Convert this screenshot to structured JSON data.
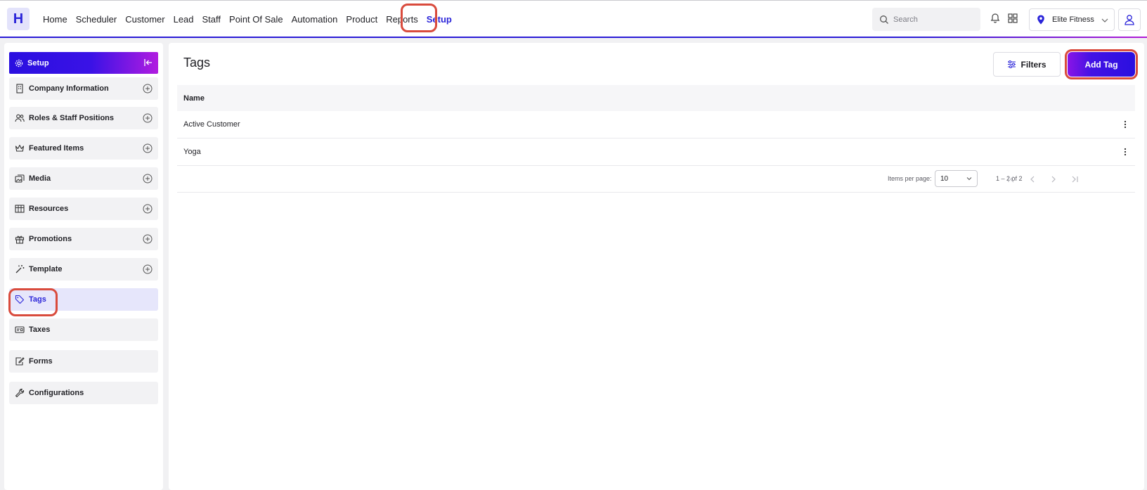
{
  "app": {
    "logo_letter": "H",
    "brand_color": "#2b25d9",
    "highlight_color": "#d94b3d"
  },
  "nav": {
    "items": [
      {
        "label": "Home"
      },
      {
        "label": "Scheduler"
      },
      {
        "label": "Customer"
      },
      {
        "label": "Lead"
      },
      {
        "label": "Staff"
      },
      {
        "label": "Point Of Sale"
      },
      {
        "label": "Automation"
      },
      {
        "label": "Product"
      },
      {
        "label": "Reports"
      },
      {
        "label": "Setup",
        "active": true
      }
    ]
  },
  "header": {
    "search_placeholder": "Search",
    "location": "Elite Fitness",
    "icons": [
      "search-icon",
      "bell-icon",
      "apps-grid-icon",
      "location-pin-icon",
      "chevron-down-icon",
      "user-icon"
    ]
  },
  "sidebar": {
    "title": "Setup",
    "items": [
      {
        "label": "Company Information",
        "icon": "building-icon",
        "expandable": true
      },
      {
        "label": "Roles & Staff Positions",
        "icon": "users-icon",
        "expandable": true
      },
      {
        "label": "Featured Items",
        "icon": "crown-icon",
        "expandable": true
      },
      {
        "label": "Media",
        "icon": "images-icon",
        "expandable": true
      },
      {
        "label": "Resources",
        "icon": "resources-icon",
        "expandable": true
      },
      {
        "label": "Promotions",
        "icon": "gift-icon",
        "expandable": true
      },
      {
        "label": "Template",
        "icon": "magic-wand-icon",
        "expandable": true
      },
      {
        "label": "Tags",
        "icon": "tag-icon",
        "active": true
      },
      {
        "label": "Taxes",
        "icon": "receipt-icon"
      },
      {
        "label": "Forms",
        "icon": "form-edit-icon"
      },
      {
        "label": "Configurations",
        "icon": "wrench-icon"
      }
    ]
  },
  "main": {
    "title": "Tags",
    "filters_label": "Filters",
    "add_label": "Add Tag",
    "table": {
      "columns": [
        "Name"
      ],
      "rows": [
        {
          "name": "Active Customer"
        },
        {
          "name": "Yoga"
        }
      ]
    },
    "paginator": {
      "items_per_page_label": "Items per page:",
      "items_per_page": "10",
      "range": "1 – 2 of 2"
    }
  }
}
